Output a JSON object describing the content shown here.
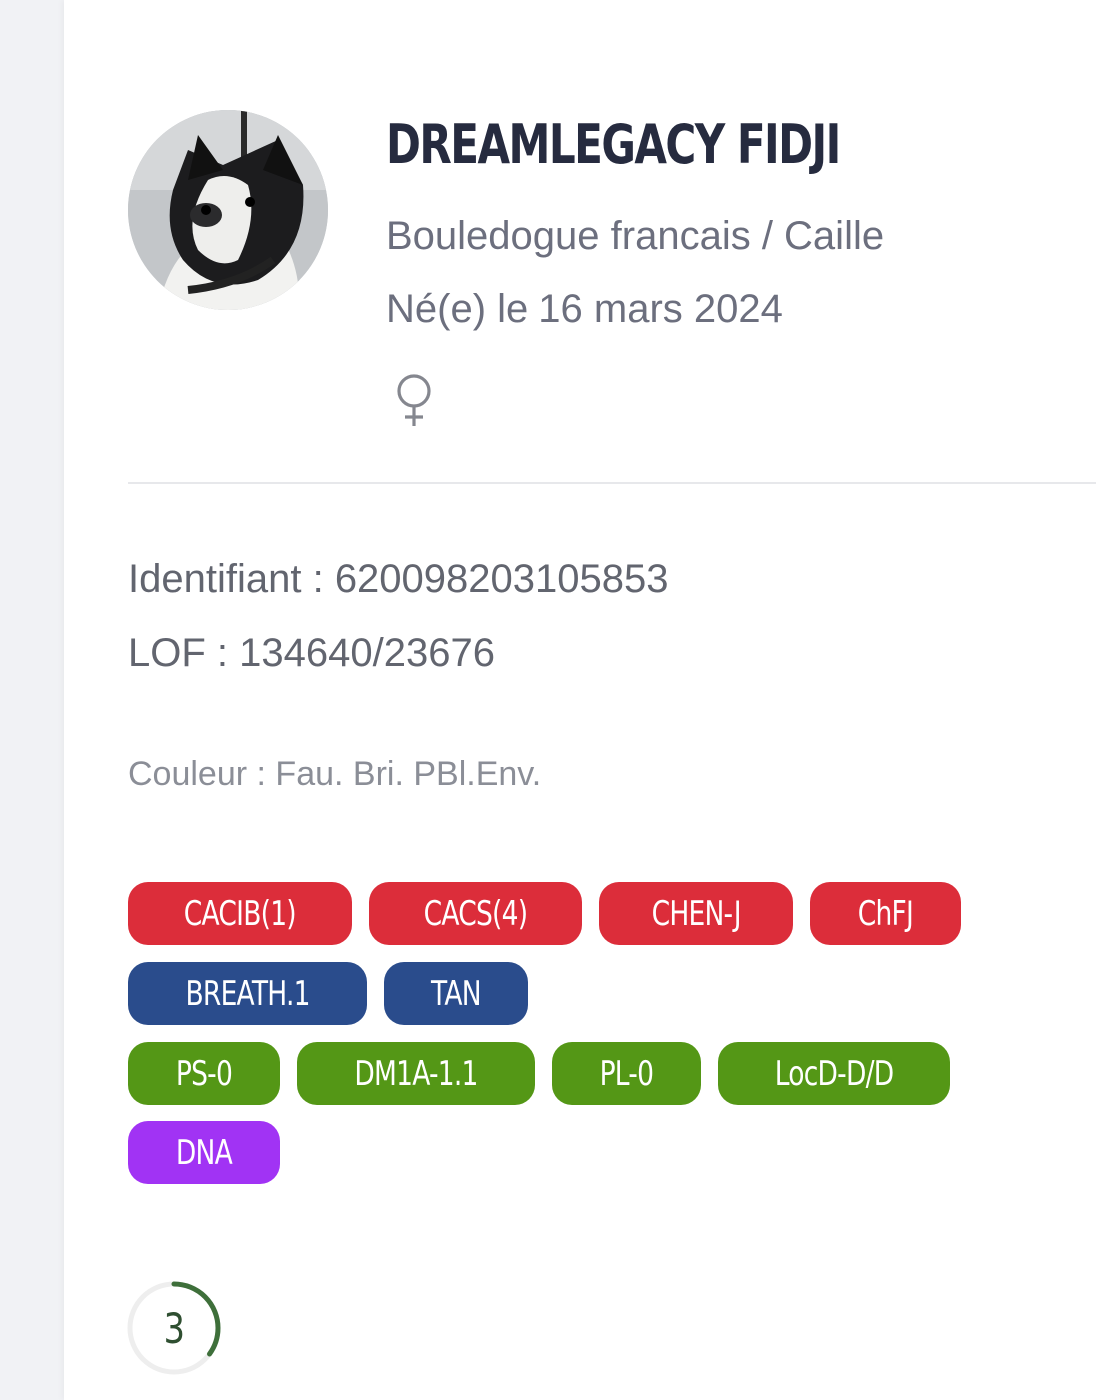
{
  "dog": {
    "name": "DREAMLEGACY FIDJI",
    "breed_color": "Bouledogue francais / Caille",
    "birth_label": "Né(e) le",
    "birth_date": "16 mars 2024",
    "sex_icon": "female-symbol-icon"
  },
  "identity": {
    "identifiant_label": "Identifiant :",
    "identifiant_value": "620098203105853",
    "lof_label": "LOF :",
    "lof_value": "134640/23676",
    "couleur_label": "Couleur :",
    "couleur_value": "Fau. Bri. PBl.Env."
  },
  "badges": {
    "awards": {
      "color": "#dc2d3a",
      "items": [
        "CACIB(1)",
        "CACS(4)",
        "CHEN-J",
        "ChFJ"
      ]
    },
    "tests": {
      "color": "#2a4c8c",
      "items": [
        "BREATH.1",
        "TAN"
      ]
    },
    "health": {
      "color": "#549716",
      "items": [
        "PS-0",
        "DM1A-1.1",
        "PL-0",
        "LocD-D/D"
      ]
    },
    "dna": {
      "color": "#a133f4",
      "items": [
        "DNA"
      ]
    }
  },
  "counter": {
    "value": "3",
    "ring_color": "#3e6f3a",
    "fraction": 0.35
  }
}
